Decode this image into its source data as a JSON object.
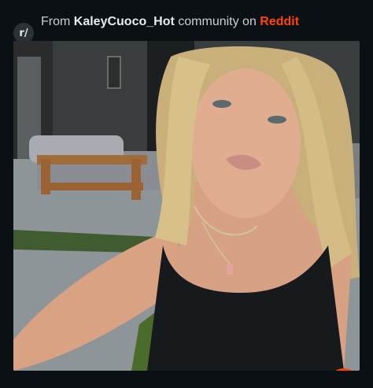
{
  "header": {
    "prefix": "From ",
    "subreddit": "KaleyCuoco_Hot",
    "middle": " community on ",
    "brand": "Reddit",
    "avatar_label": "r/"
  },
  "media": {
    "icon": "reddit-snoo-icon"
  },
  "colors": {
    "background": "#0b1014",
    "brand": "#ff4500",
    "text": "#c9ced1"
  }
}
